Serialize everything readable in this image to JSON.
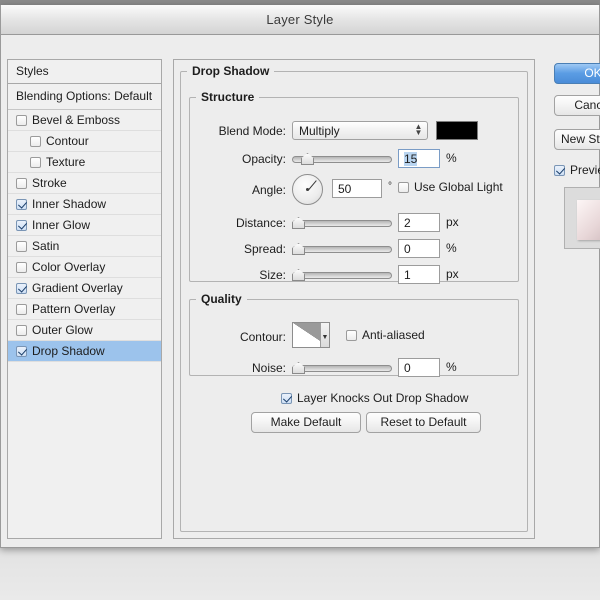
{
  "window": {
    "title": "Layer Style"
  },
  "styles_panel": {
    "header": "Styles",
    "blending_options": "Blending Options: Default",
    "effects": [
      {
        "label": "Bevel & Emboss",
        "checked": false,
        "indent": false,
        "selected": false
      },
      {
        "label": "Contour",
        "checked": false,
        "indent": true,
        "selected": false
      },
      {
        "label": "Texture",
        "checked": false,
        "indent": true,
        "selected": false
      },
      {
        "label": "Stroke",
        "checked": false,
        "indent": false,
        "selected": false
      },
      {
        "label": "Inner Shadow",
        "checked": true,
        "indent": false,
        "selected": false
      },
      {
        "label": "Inner Glow",
        "checked": true,
        "indent": false,
        "selected": false
      },
      {
        "label": "Satin",
        "checked": false,
        "indent": false,
        "selected": false
      },
      {
        "label": "Color Overlay",
        "checked": false,
        "indent": false,
        "selected": false
      },
      {
        "label": "Gradient Overlay",
        "checked": true,
        "indent": false,
        "selected": false
      },
      {
        "label": "Pattern Overlay",
        "checked": false,
        "indent": false,
        "selected": false
      },
      {
        "label": "Outer Glow",
        "checked": false,
        "indent": false,
        "selected": false
      },
      {
        "label": "Drop Shadow",
        "checked": true,
        "indent": false,
        "selected": true
      }
    ]
  },
  "main": {
    "group_title": "Drop Shadow",
    "structure": {
      "title": "Structure",
      "blend_mode_label": "Blend Mode:",
      "blend_mode_value": "Multiply",
      "shadow_color": "#000000",
      "opacity_label": "Opacity:",
      "opacity_value": "15",
      "opacity_unit": "%",
      "angle_label": "Angle:",
      "angle_value": "50",
      "angle_unit": "°",
      "use_global_light_label": "Use Global Light",
      "use_global_light_checked": false,
      "distance_label": "Distance:",
      "distance_value": "2",
      "distance_unit": "px",
      "spread_label": "Spread:",
      "spread_value": "0",
      "spread_unit": "%",
      "size_label": "Size:",
      "size_value": "1",
      "size_unit": "px"
    },
    "quality": {
      "title": "Quality",
      "contour_label": "Contour:",
      "anti_aliased_label": "Anti-aliased",
      "anti_aliased_checked": false,
      "noise_label": "Noise:",
      "noise_value": "0",
      "noise_unit": "%"
    },
    "knockout_label": "Layer Knocks Out Drop Shadow",
    "knockout_checked": true,
    "make_default_label": "Make Default",
    "reset_default_label": "Reset to Default"
  },
  "right_panel": {
    "ok_label": "OK",
    "cancel_label": "Cancel",
    "new_style_label": "New Style...",
    "preview_label": "Preview",
    "preview_checked": true
  },
  "colors": {
    "selection_blue": "#9cc3ec",
    "default_button_blue": "#5b9de4",
    "dialog_bg": "#ededed"
  }
}
